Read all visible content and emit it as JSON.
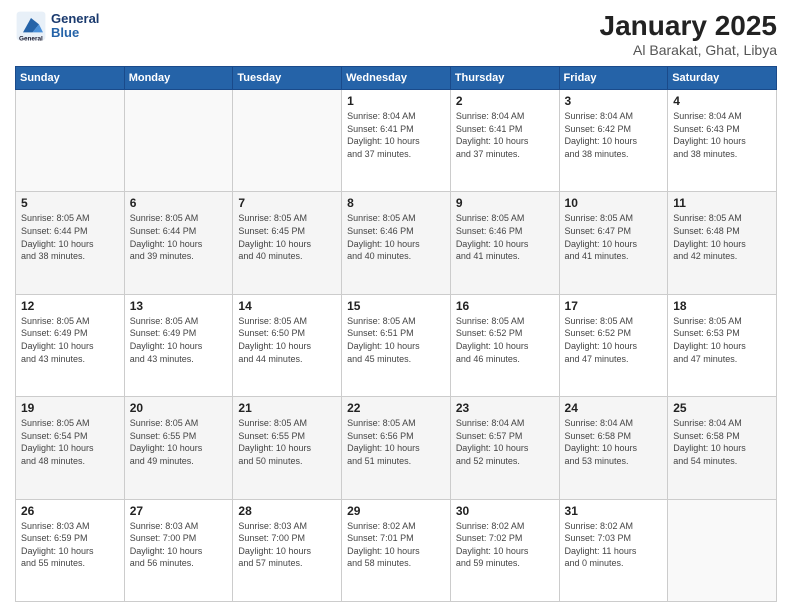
{
  "logo": {
    "line1": "General",
    "line2": "Blue"
  },
  "title": "January 2025",
  "subtitle": "Al Barakat, Ghat, Libya",
  "days_header": [
    "Sunday",
    "Monday",
    "Tuesday",
    "Wednesday",
    "Thursday",
    "Friday",
    "Saturday"
  ],
  "weeks": [
    [
      {
        "num": "",
        "info": ""
      },
      {
        "num": "",
        "info": ""
      },
      {
        "num": "",
        "info": ""
      },
      {
        "num": "1",
        "info": "Sunrise: 8:04 AM\nSunset: 6:41 PM\nDaylight: 10 hours\nand 37 minutes."
      },
      {
        "num": "2",
        "info": "Sunrise: 8:04 AM\nSunset: 6:41 PM\nDaylight: 10 hours\nand 37 minutes."
      },
      {
        "num": "3",
        "info": "Sunrise: 8:04 AM\nSunset: 6:42 PM\nDaylight: 10 hours\nand 38 minutes."
      },
      {
        "num": "4",
        "info": "Sunrise: 8:04 AM\nSunset: 6:43 PM\nDaylight: 10 hours\nand 38 minutes."
      }
    ],
    [
      {
        "num": "5",
        "info": "Sunrise: 8:05 AM\nSunset: 6:44 PM\nDaylight: 10 hours\nand 38 minutes."
      },
      {
        "num": "6",
        "info": "Sunrise: 8:05 AM\nSunset: 6:44 PM\nDaylight: 10 hours\nand 39 minutes."
      },
      {
        "num": "7",
        "info": "Sunrise: 8:05 AM\nSunset: 6:45 PM\nDaylight: 10 hours\nand 40 minutes."
      },
      {
        "num": "8",
        "info": "Sunrise: 8:05 AM\nSunset: 6:46 PM\nDaylight: 10 hours\nand 40 minutes."
      },
      {
        "num": "9",
        "info": "Sunrise: 8:05 AM\nSunset: 6:46 PM\nDaylight: 10 hours\nand 41 minutes."
      },
      {
        "num": "10",
        "info": "Sunrise: 8:05 AM\nSunset: 6:47 PM\nDaylight: 10 hours\nand 41 minutes."
      },
      {
        "num": "11",
        "info": "Sunrise: 8:05 AM\nSunset: 6:48 PM\nDaylight: 10 hours\nand 42 minutes."
      }
    ],
    [
      {
        "num": "12",
        "info": "Sunrise: 8:05 AM\nSunset: 6:49 PM\nDaylight: 10 hours\nand 43 minutes."
      },
      {
        "num": "13",
        "info": "Sunrise: 8:05 AM\nSunset: 6:49 PM\nDaylight: 10 hours\nand 43 minutes."
      },
      {
        "num": "14",
        "info": "Sunrise: 8:05 AM\nSunset: 6:50 PM\nDaylight: 10 hours\nand 44 minutes."
      },
      {
        "num": "15",
        "info": "Sunrise: 8:05 AM\nSunset: 6:51 PM\nDaylight: 10 hours\nand 45 minutes."
      },
      {
        "num": "16",
        "info": "Sunrise: 8:05 AM\nSunset: 6:52 PM\nDaylight: 10 hours\nand 46 minutes."
      },
      {
        "num": "17",
        "info": "Sunrise: 8:05 AM\nSunset: 6:52 PM\nDaylight: 10 hours\nand 47 minutes."
      },
      {
        "num": "18",
        "info": "Sunrise: 8:05 AM\nSunset: 6:53 PM\nDaylight: 10 hours\nand 47 minutes."
      }
    ],
    [
      {
        "num": "19",
        "info": "Sunrise: 8:05 AM\nSunset: 6:54 PM\nDaylight: 10 hours\nand 48 minutes."
      },
      {
        "num": "20",
        "info": "Sunrise: 8:05 AM\nSunset: 6:55 PM\nDaylight: 10 hours\nand 49 minutes."
      },
      {
        "num": "21",
        "info": "Sunrise: 8:05 AM\nSunset: 6:55 PM\nDaylight: 10 hours\nand 50 minutes."
      },
      {
        "num": "22",
        "info": "Sunrise: 8:05 AM\nSunset: 6:56 PM\nDaylight: 10 hours\nand 51 minutes."
      },
      {
        "num": "23",
        "info": "Sunrise: 8:04 AM\nSunset: 6:57 PM\nDaylight: 10 hours\nand 52 minutes."
      },
      {
        "num": "24",
        "info": "Sunrise: 8:04 AM\nSunset: 6:58 PM\nDaylight: 10 hours\nand 53 minutes."
      },
      {
        "num": "25",
        "info": "Sunrise: 8:04 AM\nSunset: 6:58 PM\nDaylight: 10 hours\nand 54 minutes."
      }
    ],
    [
      {
        "num": "26",
        "info": "Sunrise: 8:03 AM\nSunset: 6:59 PM\nDaylight: 10 hours\nand 55 minutes."
      },
      {
        "num": "27",
        "info": "Sunrise: 8:03 AM\nSunset: 7:00 PM\nDaylight: 10 hours\nand 56 minutes."
      },
      {
        "num": "28",
        "info": "Sunrise: 8:03 AM\nSunset: 7:00 PM\nDaylight: 10 hours\nand 57 minutes."
      },
      {
        "num": "29",
        "info": "Sunrise: 8:02 AM\nSunset: 7:01 PM\nDaylight: 10 hours\nand 58 minutes."
      },
      {
        "num": "30",
        "info": "Sunrise: 8:02 AM\nSunset: 7:02 PM\nDaylight: 10 hours\nand 59 minutes."
      },
      {
        "num": "31",
        "info": "Sunrise: 8:02 AM\nSunset: 7:03 PM\nDaylight: 11 hours\nand 0 minutes."
      },
      {
        "num": "",
        "info": ""
      }
    ]
  ]
}
